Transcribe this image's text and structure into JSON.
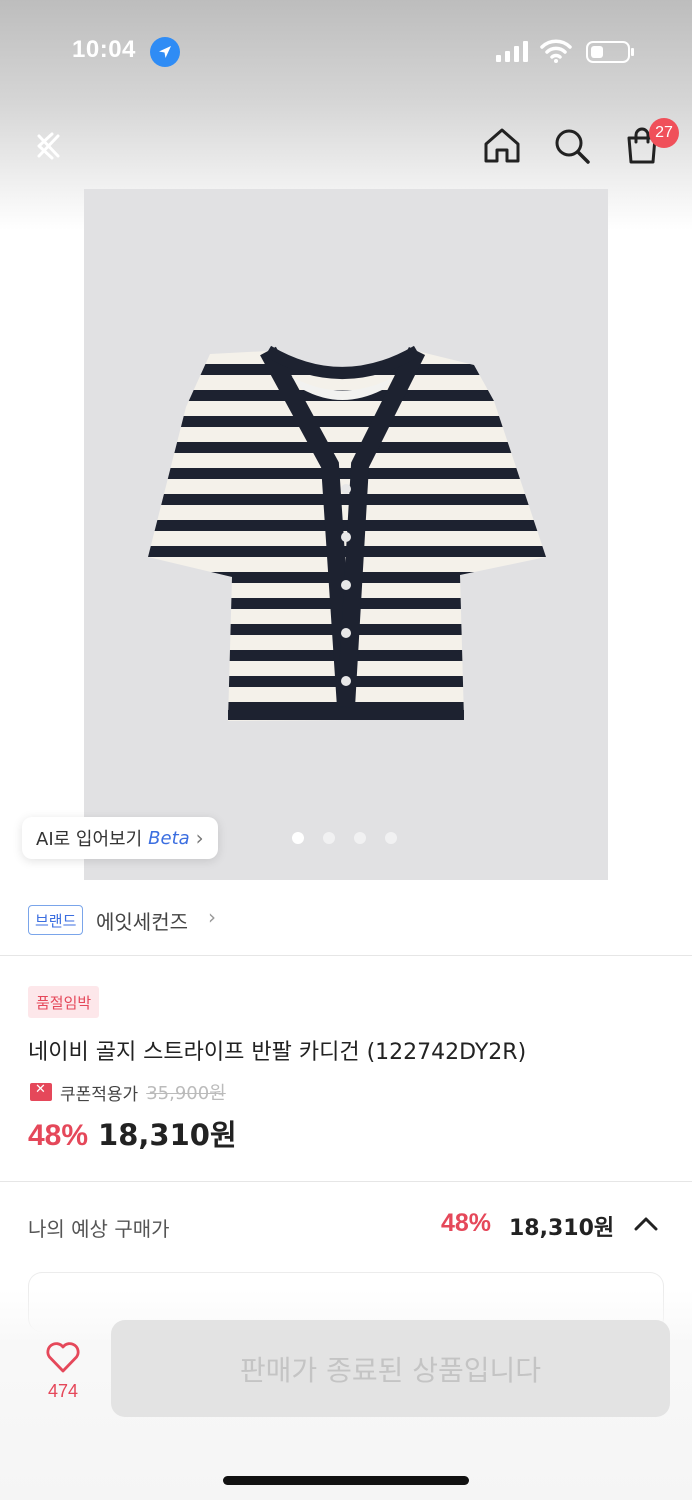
{
  "status_bar": {
    "time": "10:04"
  },
  "nav": {
    "cart_count": "27"
  },
  "gallery": {
    "ai_tryon_label": "AI로 입어보기",
    "ai_tryon_beta": "Beta",
    "chevron": "›",
    "page_dots": 4,
    "active_dot": 0
  },
  "brand": {
    "tag": "브랜드",
    "name": "에잇세컨즈",
    "chevron": "›"
  },
  "product": {
    "badge": "품절임박",
    "title": "네이비 골지 스트라이프 반팔 카디건 (122742DY2R)",
    "coupon_label": "쿠폰적용가",
    "original_price": "35,900원",
    "discount": "48%",
    "sale_price": "18,310원"
  },
  "estimate": {
    "label": "나의 예상 구매가",
    "discount": "48%",
    "price": "18,310원"
  },
  "bottom": {
    "like_count": "474",
    "buy_button": "판매가 종료된 상품입니다"
  },
  "colors": {
    "accent_red": "#e5485a",
    "brand_blue": "#3b6ee0",
    "navy_stripe": "#1d2230"
  }
}
